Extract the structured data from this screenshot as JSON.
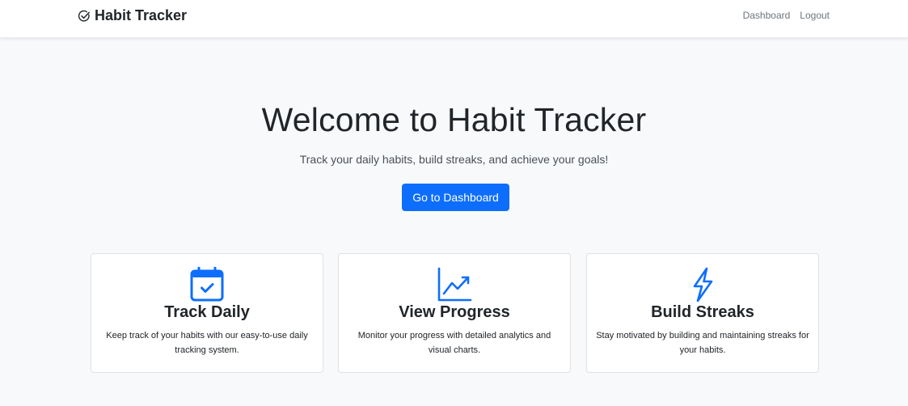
{
  "navbar": {
    "brand": "Habit Tracker",
    "brand_icon": "check-circle-icon",
    "links": [
      "Dashboard",
      "Logout"
    ]
  },
  "hero": {
    "title": "Welcome to Habit Tracker",
    "subtitle": "Track your daily habits, build streaks, and achieve your goals!",
    "button_label": "Go to Dashboard"
  },
  "features": [
    {
      "icon": "calendar-check-icon",
      "title": "Track Daily",
      "text": "Keep track of your habits with our easy-to-use daily tracking system."
    },
    {
      "icon": "graph-up-icon",
      "title": "View Progress",
      "text": "Monitor your progress with detailed analytics and visual charts."
    },
    {
      "icon": "lightning-icon",
      "title": "Build Streaks",
      "text": "Stay motivated by building and maintaining streaks for your habits."
    }
  ],
  "colors": {
    "accent": "#0d6efd",
    "background": "#f8f9fa",
    "text": "#212529",
    "muted": "#6c757d"
  }
}
